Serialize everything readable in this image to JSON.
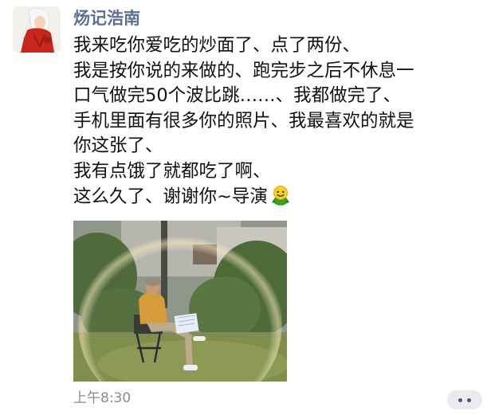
{
  "post": {
    "nickname": "炀记浩南",
    "lines": [
      "我来吃你爱吃的炒面了、点了两份、",
      "我是按你说的来做的、跑完步之后不休息一",
      "口气做完50个波比跳……、我都做完了、",
      "手机里面有很多你的照片、我最喜欢的就是",
      "你这张了、",
      "我有点饿了就都吃了啊、",
      "这么久了、谢谢你~导演"
    ],
    "emoji": "smiley-emoji",
    "photo": {
      "content": "person-sitting-reading-in-garden"
    },
    "timestamp": "上午8:30",
    "more_icon": "ellipsis-icon"
  },
  "colors": {
    "nickname": "#5e6f93",
    "text": "#111111",
    "timestamp": "#8a8a8a",
    "more_button_bg": "#ebebef"
  }
}
